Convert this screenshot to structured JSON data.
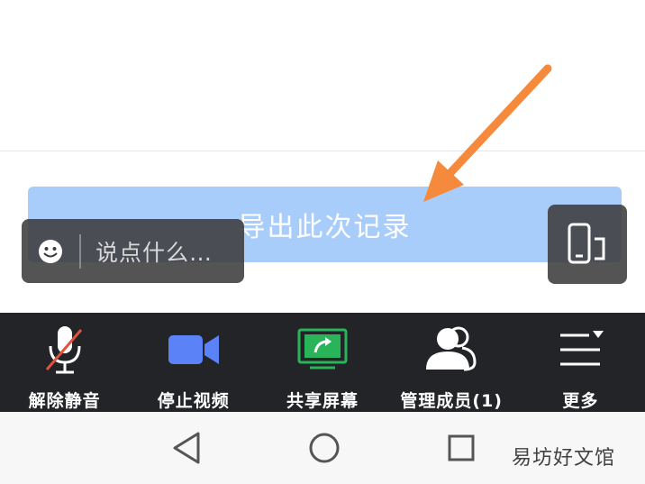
{
  "export_button": {
    "label": "导出此次记录",
    "color": "#a9cdfb"
  },
  "chat": {
    "placeholder": "说点什么…",
    "icon": "smiley-icon"
  },
  "rotate": {
    "icon": "screen-rotate-icon"
  },
  "toolbar": {
    "items": [
      {
        "label": "解除静音",
        "icon": "mic-muted-icon"
      },
      {
        "label": "停止视频",
        "icon": "video-camera-icon"
      },
      {
        "label": "共享屏幕",
        "icon": "share-screen-icon"
      },
      {
        "label": "管理成员(1)",
        "icon": "members-icon"
      },
      {
        "label": "更多",
        "icon": "more-menu-icon"
      }
    ],
    "background": "#232427",
    "video_color": "#5b82f6",
    "share_color": "#29b45a",
    "mute_slash_color": "#e0533f"
  },
  "navbar": {
    "back": "back-icon",
    "home": "home-icon",
    "recents": "recents-icon"
  },
  "watermark": {
    "text": "易坊好文馆"
  },
  "annotation": {
    "arrow_color": "#f58a3c"
  }
}
